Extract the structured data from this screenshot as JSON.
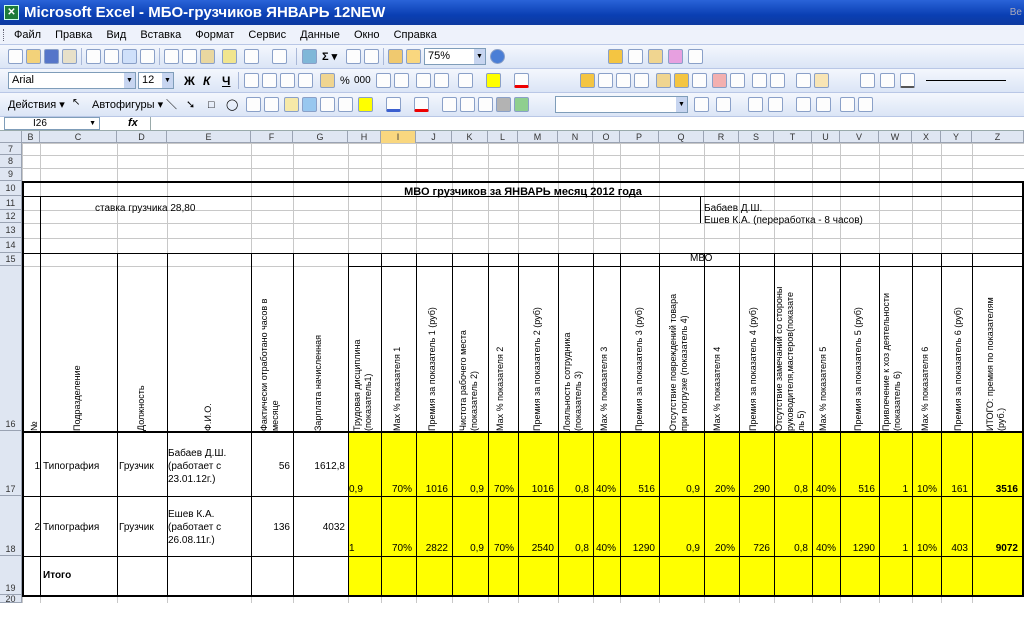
{
  "window": {
    "title": "Microsoft Excel - МБО-грузчиков ЯНВАРЬ 12NEW",
    "app_icon": "excel-icon",
    "partial_right": "Be"
  },
  "menu": [
    "Файл",
    "Правка",
    "Вид",
    "Вставка",
    "Формат",
    "Сервис",
    "Данные",
    "Окно",
    "Справка"
  ],
  "toolbar": {
    "zoom": "75%",
    "font_name": "Arial",
    "font_size": "12",
    "bold": "Ж",
    "italic": "К",
    "underline": "Ч",
    "percent": "%",
    "thousands": "000",
    "actions_menu": "Действия",
    "autoshapes_menu": "Автофигуры"
  },
  "formula_bar": {
    "name_box": "I26",
    "fx": "fx"
  },
  "columns": [
    "B",
    "C",
    "D",
    "E",
    "F",
    "G",
    "H",
    "I",
    "J",
    "K",
    "L",
    "M",
    "N",
    "O",
    "P",
    "Q",
    "R",
    "S",
    "T",
    "U",
    "V",
    "W",
    "X",
    "Y",
    "Z"
  ],
  "selected_column": "I",
  "rows": [
    "7",
    "8",
    "9",
    "10",
    "11",
    "12",
    "13",
    "14",
    "15",
    "16",
    "17",
    "18",
    "19",
    "20"
  ],
  "sheet": {
    "title": "МВО грузчиков за ЯНВАРЬ месяц 2012 года",
    "rate_label": "ставка грузчика 28,80",
    "note1": "Бабаев Д.Ш.",
    "note2": "Ешев К.А. (переработка - 8 часов)",
    "mvo_label": "МВО",
    "headers": {
      "num": "№",
      "dept": "Подразделение",
      "position": "Должность",
      "fio": "Ф.И.О.",
      "hours": "Фактически отработано часов в месяце",
      "salary": "Зарплата начисленная",
      "h": "Трудовая дисциплина (показатель1)",
      "i": "Мах % показателя 1",
      "j": "Премия за показатель 1 (руб)",
      "k": "Чистота рабочего места (показатель 2)",
      "l": "Мах % показателя 2",
      "m": "Премия за показатель 2 (руб)",
      "n": "Лояльность сотрудника (показатель 3)",
      "o": "Мах % показателя 3",
      "p": "Премия за показатель 3 (руб)",
      "q": "Отсутствие повреждений товара при погрузке (показатель 4)",
      "r": "Мах % показателя 4",
      "s": "Премия за показатель 4 (руб)",
      "t": "Отсутствие замечаний со стороны руководителя,мастеров(показате ль 5)",
      "u": "Мах % показателя 5",
      "v": "Премия за показатель 5 (руб)",
      "w": "Привлечение к хоз деятельности (показатель 6)",
      "x": "Мах % показателя 6",
      "y": "Премия за показатель 6 (руб)",
      "z": "ИТОГО: премия по показателям (руб.)"
    },
    "records": [
      {
        "num": "1",
        "dept": "Типография",
        "position": "Грузчик",
        "fio": [
          "Бабаев Д.Ш.",
          "(работает с",
          "23.01.12г.)"
        ],
        "hours": "56",
        "salary": "1612,8",
        "h": "0,9",
        "i": "70%",
        "j": "1016",
        "k": "0,9",
        "l": "70%",
        "m": "1016",
        "n": "0,8",
        "o": "40%",
        "p": "516",
        "q": "0,9",
        "r": "20%",
        "s": "290",
        "t": "0,8",
        "u": "40%",
        "v": "516",
        "w": "1",
        "x": "10%",
        "y": "161",
        "z": "3516"
      },
      {
        "num": "2",
        "dept": "Типография",
        "position": "Грузчик",
        "fio": [
          "Ешев К.А.",
          "(работает с",
          "26.08.11г.)"
        ],
        "hours": "136",
        "salary": "4032",
        "h": "1",
        "i": "70%",
        "j": "2822",
        "k": "0,9",
        "l": "70%",
        "m": "2540",
        "n": "0,8",
        "o": "40%",
        "p": "1290",
        "q": "0,9",
        "r": "20%",
        "s": "726",
        "t": "0,8",
        "u": "40%",
        "v": "1290",
        "w": "1",
        "x": "10%",
        "y": "403",
        "z": "9072"
      }
    ],
    "total_label": "Итого"
  }
}
